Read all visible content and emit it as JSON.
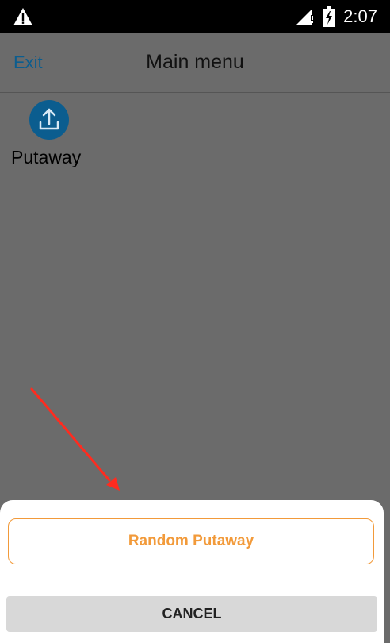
{
  "status_bar": {
    "time": "2:07",
    "icons": [
      "warning-icon",
      "signal-icon",
      "battery-charging-icon"
    ]
  },
  "app_bar": {
    "exit_label": "Exit",
    "title": "Main menu"
  },
  "menu": {
    "items": [
      {
        "label": "Putaway",
        "icon": "upload-icon"
      }
    ]
  },
  "action_sheet": {
    "options": [
      "Random Putaway"
    ],
    "cancel_label": "CANCEL"
  },
  "colors": {
    "accent": "#f29a3a",
    "link": "#0b5d8f",
    "icon_bg": "#0b5d8f",
    "annotation_arrow": "#ff2b1f"
  }
}
